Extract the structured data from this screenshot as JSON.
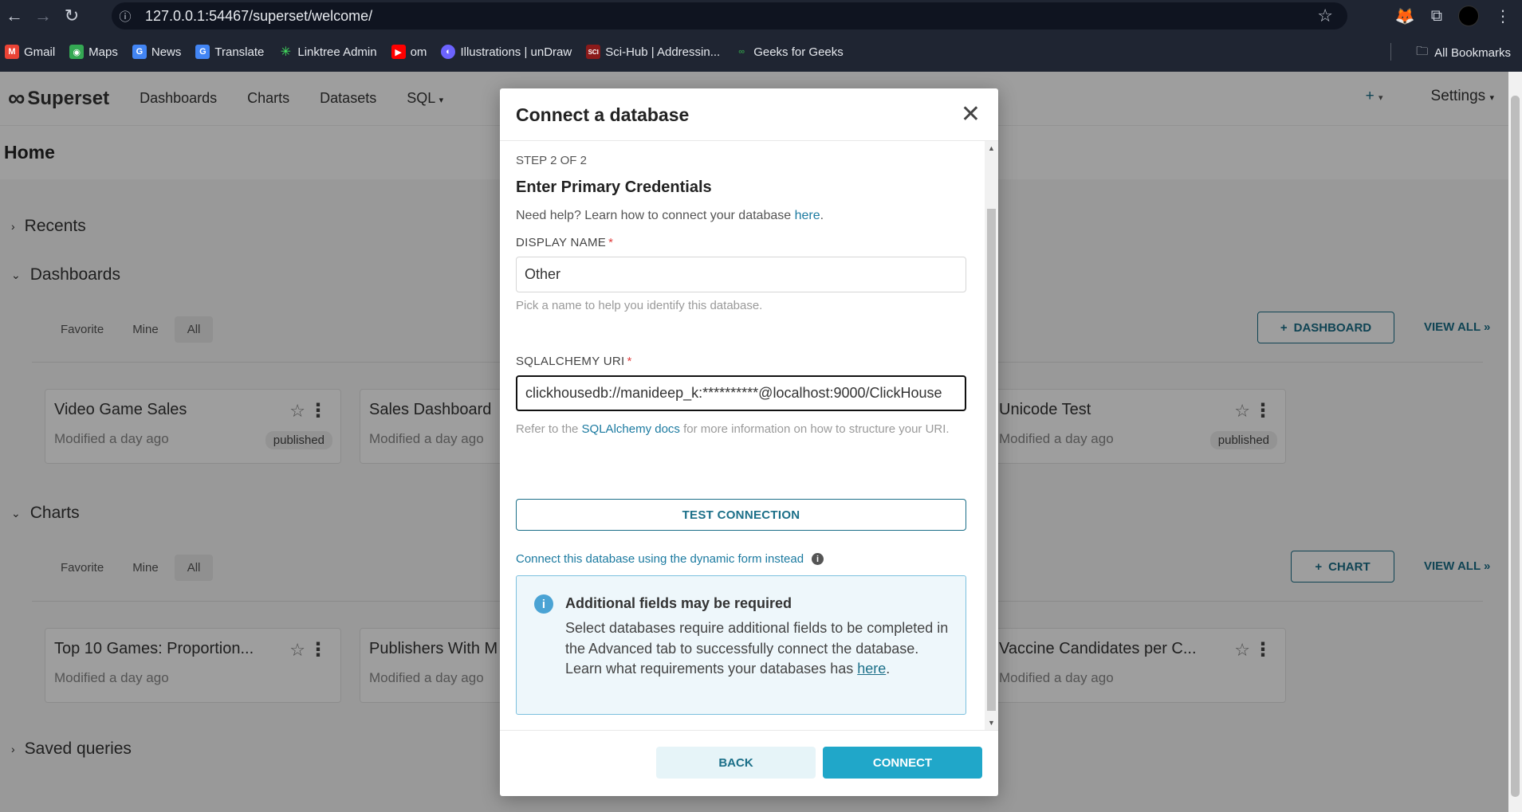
{
  "browser": {
    "url": "127.0.0.1:54467/superset/welcome/",
    "bookmarks": [
      "Gmail",
      "Maps",
      "News",
      "Translate",
      "Linktree Admin",
      "om",
      "Illustrations | unDraw",
      "Sci-Hub | Addressin...",
      "Geeks for Geeks"
    ],
    "all_bookmarks": "All Bookmarks"
  },
  "app": {
    "brand": "Superset",
    "nav": [
      "Dashboards",
      "Charts",
      "Datasets",
      "SQL"
    ],
    "settings": "Settings",
    "page_title": "Home",
    "sections": {
      "recents": "Recents",
      "dashboards": "Dashboards",
      "charts": "Charts",
      "saved_queries": "Saved queries"
    },
    "tabs": [
      "Favorite",
      "Mine",
      "All"
    ],
    "add_dashboard": "DASHBOARD",
    "add_chart": "CHART",
    "view_all": "VIEW ALL »",
    "dashboard_cards": [
      {
        "title": "Video Game Sales",
        "modified": "Modified a day ago",
        "badge": "published"
      },
      {
        "title": "Sales Dashboard",
        "modified": "Modified a day ago",
        "badge": ""
      },
      {
        "title": "Unicode Test",
        "modified": "Modified a day ago",
        "badge": "published"
      }
    ],
    "chart_cards": [
      {
        "title": "Top 10 Games: Proportion...",
        "modified": "Modified a day ago"
      },
      {
        "title": "Publishers With M",
        "modified": "Modified a day ago"
      },
      {
        "title": "Vaccine Candidates per C...",
        "modified": "Modified a day ago"
      }
    ]
  },
  "modal": {
    "title": "Connect a database",
    "step": "STEP 2 OF 2",
    "subtitle": "Enter Primary Credentials",
    "help_text": "Need help? Learn how to connect your database ",
    "help_link": "here",
    "display_name_label": "DISPLAY NAME",
    "display_name_value": "Other",
    "display_name_hint": "Pick a name to help you identify this database.",
    "uri_label": "SQLALCHEMY URI",
    "uri_value": "clickhousedb://manideep_k:**********@localhost:9000/ClickHouse",
    "uri_hint_prefix": "Refer to the ",
    "uri_hint_link": "SQLAlchemy docs",
    "uri_hint_suffix": " for more information on how to structure your URI.",
    "test_connection": "TEST CONNECTION",
    "dynamic_form_link": "Connect this database using the dynamic form instead",
    "alert_title": "Additional fields may be required",
    "alert_body": "Select databases require additional fields to be completed in the Advanced tab to successfully connect the database. Learn what requirements your databases has ",
    "alert_link": "here",
    "back": "BACK",
    "connect": "CONNECT"
  }
}
